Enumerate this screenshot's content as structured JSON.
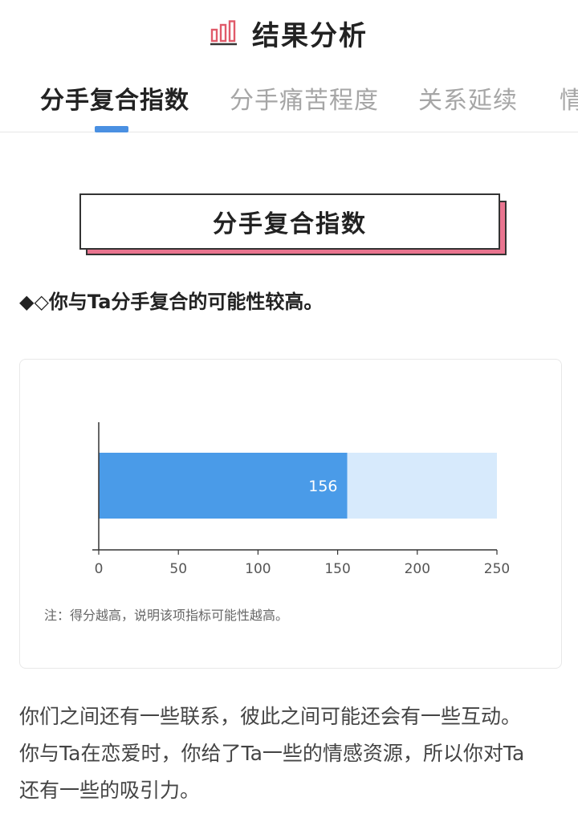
{
  "header": {
    "title": "结果分析",
    "icon": "bar-chart-icon"
  },
  "tabs": [
    {
      "label": "分手复合指数",
      "active": true
    },
    {
      "label": "分手痛苦程度",
      "active": false
    },
    {
      "label": "关系延续",
      "active": false
    },
    {
      "label": "情",
      "active": false
    }
  ],
  "section": {
    "title": "分手复合指数",
    "summary": "◆◇你与Ta分手复合的可能性较高。"
  },
  "colors": {
    "accent": "#4a90e2",
    "bar_fill": "#4a9be8",
    "bar_track": "#d7eafc",
    "title_shadow": "#e9748f"
  },
  "chart_data": {
    "type": "bar",
    "orientation": "horizontal",
    "values": [
      156
    ],
    "max": 250,
    "xlim": [
      0,
      250
    ],
    "xticks": [
      0,
      50,
      100,
      150,
      200,
      250
    ],
    "data_labels": [
      "156"
    ],
    "note": "注：得分越高，说明该项指标可能性越高。"
  },
  "description": [
    "你们之间还有一些联系，彼此之间可能还会有一些互动。",
    "你与Ta在恋爱时，你给了Ta一些的情感资源，所以你对Ta",
    "还有一些的吸引力。"
  ]
}
